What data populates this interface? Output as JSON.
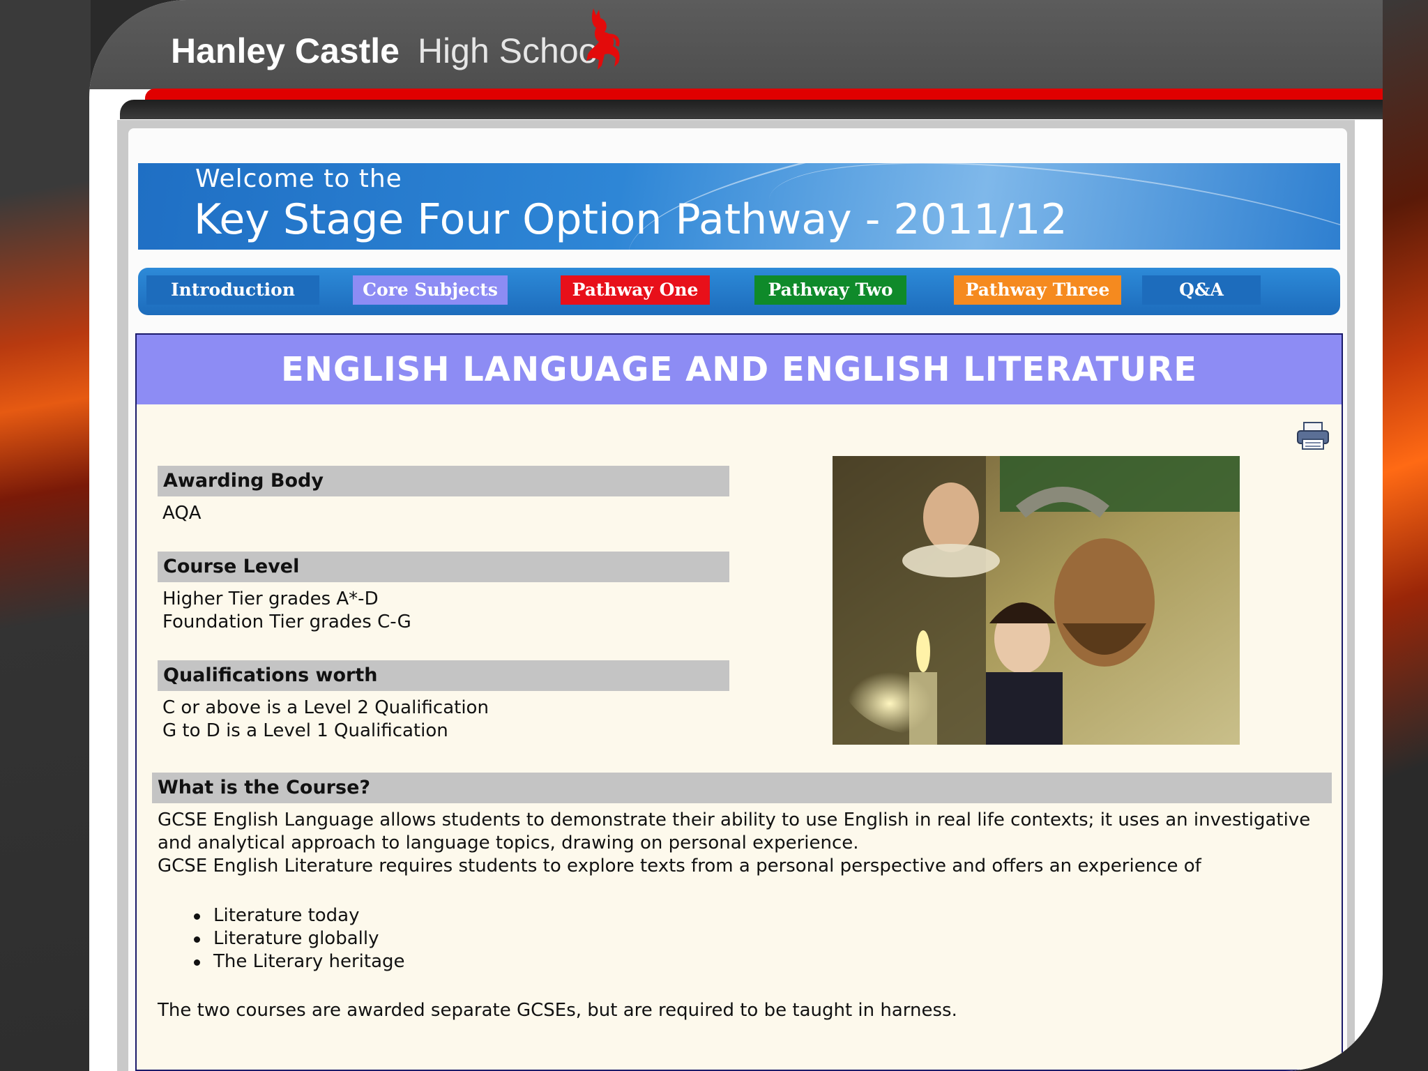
{
  "header": {
    "school_bold": "Hanley Castle",
    "school_light": "High Schoo"
  },
  "banner": {
    "welcome": "Welcome to the",
    "title": "Key Stage Four Option Pathway - 2011/12"
  },
  "nav": {
    "items": [
      {
        "label": "Introduction",
        "color": "#1d6cbc"
      },
      {
        "label": "Core Subjects",
        "color": "#8d8cf4"
      },
      {
        "label": "Pathway One",
        "color": "#e8101a"
      },
      {
        "label": "Pathway Two",
        "color": "#0f8a2a"
      },
      {
        "label": "Pathway Three",
        "color": "#f58a1f"
      },
      {
        "label": "Q&A",
        "color": "#1d6cbc"
      }
    ]
  },
  "content": {
    "title": "ENGLISH LANGUAGE AND ENGLISH LITERATURE",
    "awarding_body": {
      "heading": "Awarding Body",
      "lines": [
        "AQA"
      ]
    },
    "course_level": {
      "heading": "Course Level",
      "lines": [
        "Higher Tier grades A*-D",
        "Foundation Tier grades C-G"
      ]
    },
    "qualifications": {
      "heading": "Qualifications worth",
      "lines": [
        "C or above is a Level 2 Qualification",
        "G to D is a Level 1 Qualification"
      ]
    },
    "course": {
      "heading": "What is the Course?",
      "para1": "GCSE English Language allows students to demonstrate their ability to use English in real life contexts; it uses an investigative and analytical approach to language topics, drawing on personal experience.",
      "para2": "GCSE English Literature requires students to explore texts from a personal perspective and offers an experience of",
      "bullets": [
        "Literature today",
        "Literature globally",
        "The Literary heritage"
      ],
      "closing": "The two courses are awarded separate GCSEs, but are required to be taught in harness."
    }
  },
  "colors": {
    "header_gray": "#555555",
    "accent_red": "#e00000",
    "title_purple": "#8d8cf4",
    "content_bg": "#fdf9ec",
    "section_gray": "#c4c4c4"
  }
}
